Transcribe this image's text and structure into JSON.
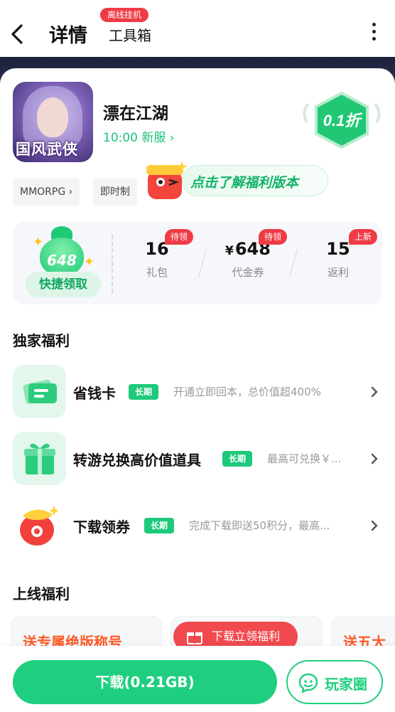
{
  "header": {
    "title": "详情",
    "toolbox_label": "工具箱",
    "toolbox_badge": "离线挂机"
  },
  "game": {
    "icon_text": "国风武侠",
    "name": "漂在江湖",
    "server": "10:00 新服 ›",
    "discount": "0.1折",
    "tags": [
      "MMORPG ›",
      "即时制"
    ]
  },
  "promo": {
    "text": "点击了解福利版本"
  },
  "benefit": {
    "bag_value": "648",
    "quick_label": "快捷领取",
    "stats": [
      {
        "value": "16",
        "label": "礼包",
        "badge": "待领"
      },
      {
        "prefix": "¥",
        "value": "648",
        "label": "代金券",
        "badge": "待领"
      },
      {
        "value": "15",
        "label": "返利",
        "badge": "上新"
      }
    ]
  },
  "exclusive": {
    "title": "独家福利",
    "items": [
      {
        "title": "省钱卡",
        "tag": "长期",
        "desc": "开通立即回本，总价值超400%"
      },
      {
        "title": "转游兑换高价值道具",
        "tag": "长期",
        "desc": "最高可兑换￥..."
      },
      {
        "title": "下载领券",
        "tag": "长期",
        "desc": "完成下载即送50积分，最高..."
      }
    ]
  },
  "online": {
    "title": "上线福利",
    "cards": [
      "送专属绝版称号",
      "",
      "送五大"
    ]
  },
  "floating": {
    "label": "下载立领福利"
  },
  "bottom": {
    "download_label": "下载(0.21GB)",
    "circle_label": "玩家圈"
  },
  "colors": {
    "accent": "#1fcf7f",
    "badge_red": "#ef3b46"
  }
}
